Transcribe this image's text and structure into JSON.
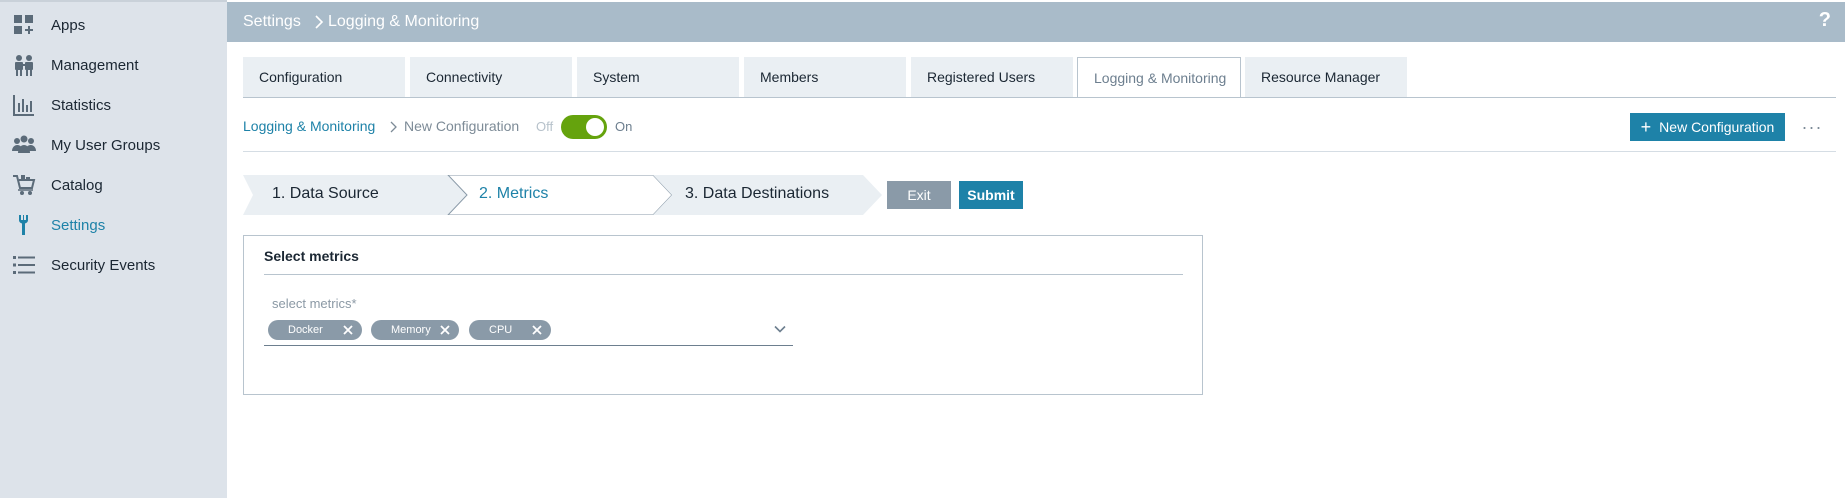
{
  "sidebar": {
    "items": [
      {
        "label": "Apps",
        "icon": "apps-icon"
      },
      {
        "label": "Management",
        "icon": "people-icon"
      },
      {
        "label": "Statistics",
        "icon": "bar-chart-icon"
      },
      {
        "label": "My User Groups",
        "icon": "user-group-icon"
      },
      {
        "label": "Catalog",
        "icon": "cart-icon"
      },
      {
        "label": "Settings",
        "icon": "wrench-icon",
        "active": true
      },
      {
        "label": "Security Events",
        "icon": "list-icon"
      }
    ]
  },
  "header": {
    "breadcrumb_root": "Settings",
    "breadcrumb_current": "Logging & Monitoring",
    "help": "?"
  },
  "tabs": [
    {
      "label": "Configuration"
    },
    {
      "label": "Connectivity"
    },
    {
      "label": "System"
    },
    {
      "label": "Members"
    },
    {
      "label": "Registered Users"
    },
    {
      "label": "Logging & Monitoring",
      "active": true
    },
    {
      "label": "Resource Manager"
    }
  ],
  "subheader": {
    "link": "Logging & Monitoring",
    "current": "New Configuration",
    "toggle_off_label": "Off",
    "toggle_on_label": "On",
    "toggle_state": true,
    "new_config_label": "New Configuration",
    "more_label": "···"
  },
  "wizard": {
    "steps": [
      {
        "label": "1. Data Source"
      },
      {
        "label": "2. Metrics",
        "active": true
      },
      {
        "label": "3. Data Destinations"
      }
    ],
    "exit_label": "Exit",
    "submit_label": "Submit"
  },
  "card": {
    "title": "Select metrics",
    "field_label": "select metrics",
    "required_mark": "*",
    "chips": [
      "Docker",
      "Memory",
      "CPU"
    ]
  },
  "colors": {
    "accent": "#1e82a8",
    "sidebar_bg": "#dde3ea",
    "header_bg": "#a9bbc9",
    "toggle_on": "#65a30d",
    "chip_bg": "#8a9aa8"
  }
}
